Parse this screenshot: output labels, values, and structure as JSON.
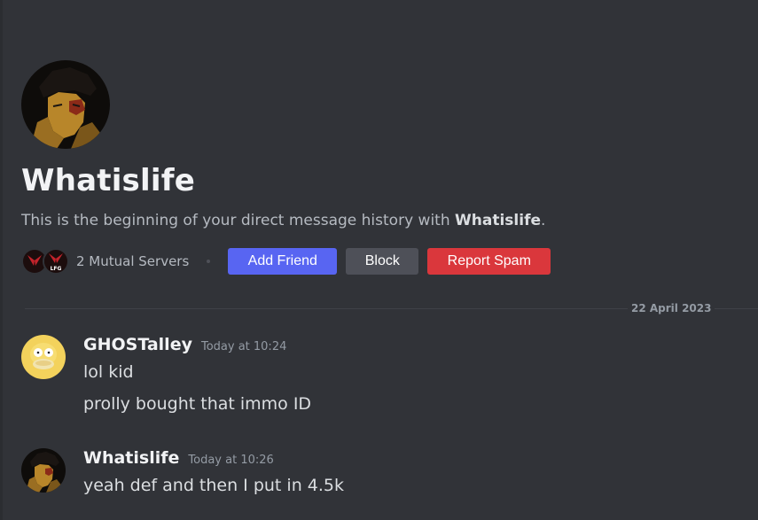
{
  "profile": {
    "username": "Whatislife",
    "intro_prefix": "This is the beginning of your direct message history with ",
    "intro_name": "Whatislife",
    "intro_suffix": ".",
    "mutual_servers": "2 Mutual Servers",
    "mutual_icon_label": "LFG"
  },
  "buttons": {
    "add_friend": "Add Friend",
    "block": "Block",
    "report_spam": "Report Spam"
  },
  "date_divider": "22 April 2023",
  "messages": [
    {
      "author": "GHOSTalley",
      "time": "Today at 10:24",
      "lines": [
        "lol kid",
        "prolly bought that immo ID"
      ]
    },
    {
      "author": "Whatislife",
      "time": "Today at 10:26",
      "lines": [
        "yeah def and then I put in 4.5k"
      ]
    }
  ],
  "colors": {
    "background": "#313338",
    "primary": "#5865f2",
    "secondary": "#4e5058",
    "danger": "#da373c"
  }
}
